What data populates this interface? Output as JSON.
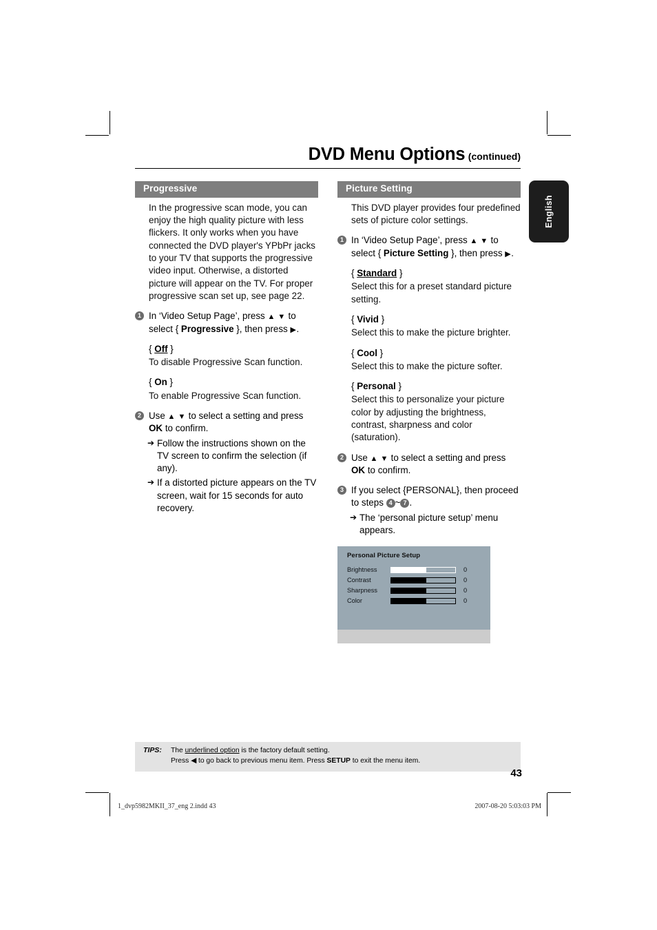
{
  "header": {
    "title_main": "DVD Menu Options",
    "title_sub": "(continued)"
  },
  "lang_tab": {
    "label": "English"
  },
  "left_column": {
    "section_title": "Progressive",
    "intro": "In the progressive scan mode, you can enjoy the high quality picture with less flickers. It only works when you have connected the DVD player's YPbPr jacks to your TV that supports the progressive video input. Otherwise, a distorted picture will appear on the TV. For proper progressive scan set up, see page 22.",
    "step1": {
      "num": "1",
      "text_a": "In ‘Video Setup Page’, press ",
      "arrows": "▲ ▼",
      "text_b": " to select { ",
      "bold": "Progressive",
      "text_c": " }, then press ",
      "arrow_right": "▶",
      "text_d": "."
    },
    "options": [
      {
        "open": "{ ",
        "name": "Off",
        "close": " }",
        "underlined": true,
        "desc": "To disable Progressive Scan function."
      },
      {
        "open": "{ ",
        "name": "On",
        "close": " }",
        "underlined": false,
        "desc": "To enable Progressive Scan function."
      }
    ],
    "step2": {
      "num": "2",
      "text_a": "Use ",
      "arrows": "▲ ▼",
      "text_b": " to select a setting and press ",
      "bold": "OK",
      "text_c": " to confirm.",
      "subs": [
        "Follow the instructions shown on the TV screen to confirm the selection (if any).",
        "If a distorted picture appears on the TV screen, wait for 15 seconds for auto recovery."
      ]
    }
  },
  "right_column": {
    "section_title": "Picture Setting",
    "intro": "This DVD player provides four predefined sets of picture color settings.",
    "step1": {
      "num": "1",
      "text_a": "In ‘Video Setup Page’, press ",
      "arrows": "▲ ▼",
      "text_b": " to select { ",
      "bold": "Picture Setting",
      "text_c": " }, then press ",
      "arrow_right": "▶",
      "text_d": "."
    },
    "options": [
      {
        "open": "{ ",
        "name": "Standard",
        "close": " }",
        "underlined": true,
        "desc": "Select this for a preset standard picture setting."
      },
      {
        "open": "{ ",
        "name": "Vivid",
        "close": " }",
        "underlined": false,
        "desc": "Select this to make the picture brighter."
      },
      {
        "open": "{ ",
        "name": "Cool",
        "close": " }",
        "underlined": false,
        "desc": "Select this to make the picture softer."
      },
      {
        "open": "{ ",
        "name": "Personal",
        "close": " }",
        "underlined": false,
        "desc": "Select this to personalize your picture color by adjusting the brightness, contrast, sharpness and color (saturation)."
      }
    ],
    "step2": {
      "num": "2",
      "text_a": "Use ",
      "arrows": "▲ ▼",
      "text_b": " to select a setting and press ",
      "bold": "OK",
      "text_c": " to confirm."
    },
    "step3": {
      "num": "3",
      "text_a": "If you select {PERSONAL}, then proceed to steps ",
      "step_from": "4",
      "tilde": "~",
      "step_to": "7",
      "text_b": ".",
      "sub": "The ‘personal picture setup’ menu appears."
    }
  },
  "osd": {
    "title": "Personal Picture Setup",
    "rows": [
      {
        "label": "Brightness",
        "value": "0",
        "fill_pct": 55,
        "fill_style": "white"
      },
      {
        "label": "Contrast",
        "value": "0",
        "fill_pct": 55,
        "fill_style": "black"
      },
      {
        "label": "Sharpness",
        "value": "0",
        "fill_pct": 55,
        "fill_style": "black"
      },
      {
        "label": "Color",
        "value": "0",
        "fill_pct": 55,
        "fill_style": "black"
      }
    ]
  },
  "tips": {
    "label": "TIPS:",
    "line1_a": "The ",
    "line1_u": "underlined option",
    "line1_b": " is the factory default setting.",
    "line2_a": "Press ",
    "line2_arrow": "◀",
    "line2_b": " to go back to previous menu item. Press ",
    "line2_bold": "SETUP",
    "line2_c": " to exit the menu item."
  },
  "page_number": "43",
  "print_footer": {
    "left": "1_dvp5982MKII_37_eng 2.indd   43",
    "right": "2007-08-20   5:03:03 PM"
  }
}
